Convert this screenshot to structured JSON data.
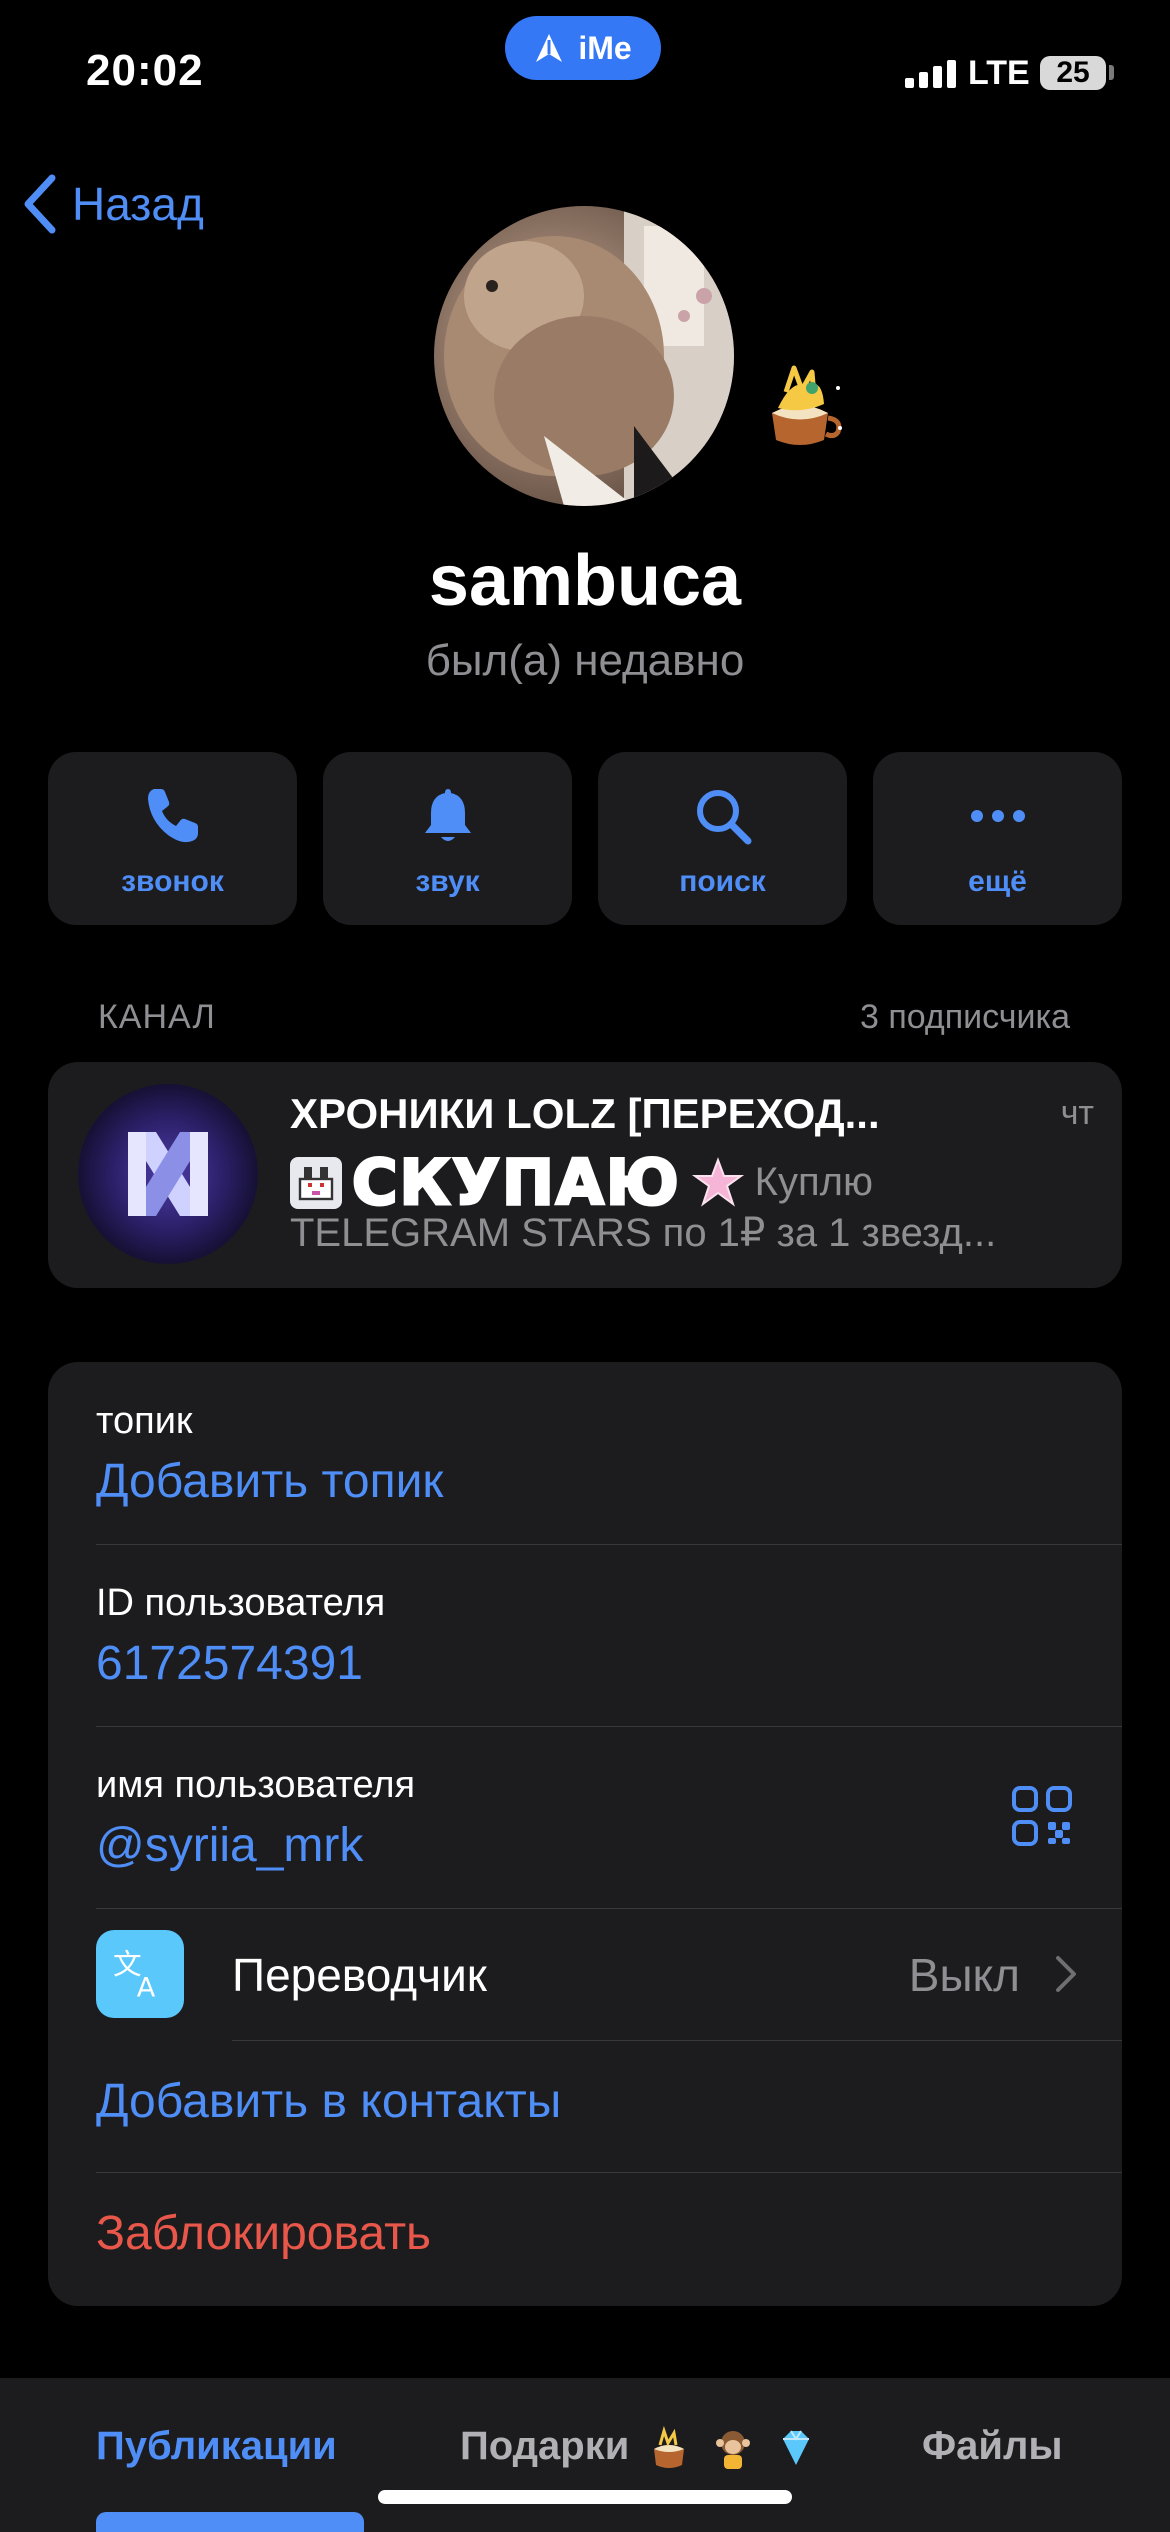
{
  "status_bar": {
    "time": "20:02",
    "center_pill": "iMe",
    "network": "LTE",
    "battery": "25"
  },
  "nav": {
    "back_label": "Назад"
  },
  "profile": {
    "name": "sambuca",
    "status": "был(а) недавно"
  },
  "actions": [
    {
      "label": "звонок",
      "icon": "phone-icon"
    },
    {
      "label": "звук",
      "icon": "bell-icon"
    },
    {
      "label": "поиск",
      "icon": "search-icon"
    },
    {
      "label": "ещё",
      "icon": "more-icon"
    }
  ],
  "channel_section": {
    "header": "КАНАЛ",
    "subscribers": "3 подписчика",
    "title": "ХРОНИКИ LOLZ [ПЕРЕХОД...",
    "day": "чт",
    "preview_big": "СКУПАЮ",
    "preview_word": "Куплю",
    "preview_line3": "TELEGRAM STARS по 1₽ за 1 звезд..."
  },
  "info": {
    "topic_label": "топик",
    "topic_value": "Добавить топик",
    "id_label": "ID пользователя",
    "id_value": "6172574391",
    "username_label": "имя пользователя",
    "username_value": "@syriia_mrk",
    "translator_label": "Переводчик",
    "translator_value": "Выкл",
    "add_contact": "Добавить в контакты",
    "block": "Заблокировать"
  },
  "colors": {
    "accent": "#4f8ef7",
    "danger": "#e8574a",
    "card": "#1c1c1e",
    "background": "#000000"
  },
  "tabs": [
    {
      "label": "Публикации",
      "active": true
    },
    {
      "label": "Подарки",
      "active": false
    },
    {
      "label": "Файлы",
      "active": false
    }
  ]
}
